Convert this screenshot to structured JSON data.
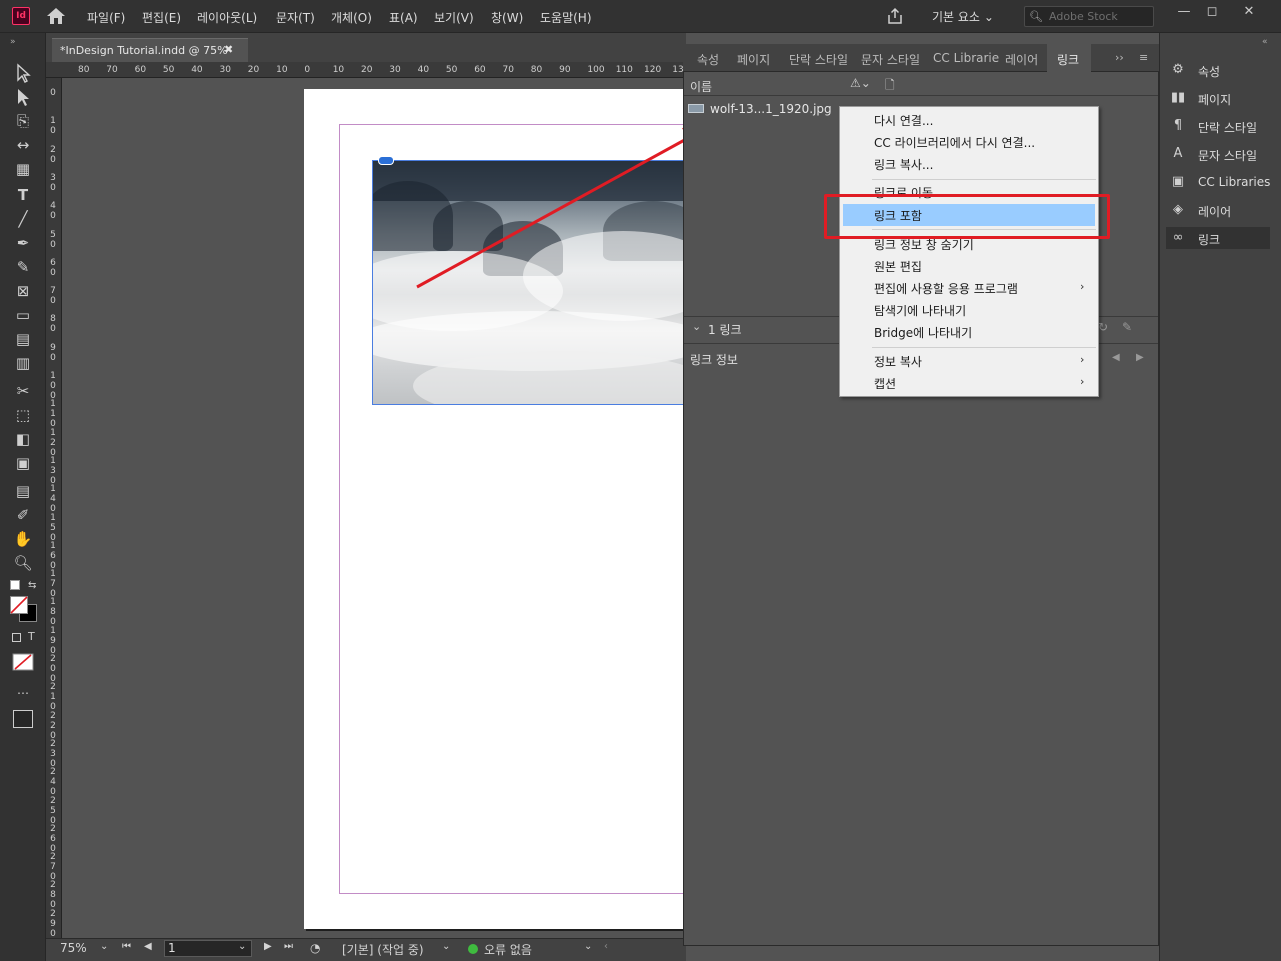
{
  "menubar": {
    "logo": "Id",
    "items": [
      "파일(F)",
      "편집(E)",
      "레이아웃(L)",
      "문자(T)",
      "개체(O)",
      "표(A)",
      "보기(V)",
      "창(W)",
      "도움말(H)"
    ],
    "workspace": "기본 요소",
    "stock_placeholder": "Adobe Stock",
    "win_minimize": "—",
    "win_restore": "◻",
    "win_close": "✕"
  },
  "document": {
    "tab_title": "*InDesign Tutorial.indd @ 75%",
    "tab_close": "✖"
  },
  "ruler": {
    "h_labels": [
      "80",
      "70",
      "60",
      "50",
      "40",
      "30",
      "20",
      "10",
      "0",
      "10",
      "20",
      "30",
      "40",
      "50",
      "60",
      "70",
      "80",
      "90",
      "100",
      "110",
      "120",
      "13"
    ],
    "v_labels": [
      "0",
      "1\n0",
      "2\n0",
      "3\n0",
      "4\n0",
      "5\n0",
      "6\n0",
      "7\n0",
      "8\n0",
      "9\n0",
      "1\n0\n0",
      "1\n1\n0",
      "1\n2\n0",
      "1\n3\n0",
      "1\n4\n0",
      "1\n5\n0",
      "1\n6\n0",
      "1\n7\n0",
      "1\n8\n0",
      "1\n9\n0",
      "2\n0\n0",
      "2\n1\n0",
      "2\n2\n0",
      "2\n3\n0",
      "2\n4\n0",
      "2\n5\n0",
      "2\n6\n0",
      "2\n7\n0",
      "2\n8\n0",
      "2\n9\n0"
    ]
  },
  "statusbar": {
    "zoom": "75%",
    "page": "1",
    "profile": "[기본] (작업 중)",
    "errors": "오류 없음"
  },
  "panel": {
    "tabs": [
      "속성",
      "페이지",
      "단락 스타일",
      "문자 스타일",
      "CC Librarie",
      "레이어",
      "링크"
    ],
    "col_name": "이름",
    "link_file": "wolf-13...1_1920.jpg",
    "link_count": "1 링크",
    "link_info": "링크 정보"
  },
  "context_menu": {
    "items": [
      {
        "label": "다시 연결...",
        "submenu": false
      },
      {
        "label": "CC 라이브러리에서 다시 연결...",
        "submenu": false
      },
      {
        "label": "링크 복사...",
        "submenu": false
      },
      {
        "label": "링크로 이동",
        "submenu": false
      },
      {
        "label": "링크 포함",
        "submenu": false,
        "highlighted": true
      },
      {
        "label": "링크 정보 창 숨기기",
        "submenu": false
      },
      {
        "label": "원본 편집",
        "submenu": false
      },
      {
        "label": "편집에 사용할 응용 프로그램",
        "submenu": true
      },
      {
        "label": "탐색기에 나타내기",
        "submenu": false
      },
      {
        "label": "Bridge에 나타내기",
        "submenu": false
      },
      {
        "label": "정보 복사",
        "submenu": true
      },
      {
        "label": "캡션",
        "submenu": true
      }
    ],
    "arrow": "›"
  },
  "dock": {
    "items": [
      {
        "label": "속성",
        "icon": "properties-icon"
      },
      {
        "label": "페이지",
        "icon": "pages-icon"
      },
      {
        "label": "단락 스타일",
        "icon": "paragraph-style-icon"
      },
      {
        "label": "문자 스타일",
        "icon": "character-style-icon"
      },
      {
        "label": "CC Libraries",
        "icon": "cc-libraries-icon"
      },
      {
        "label": "레이어",
        "icon": "layers-icon"
      },
      {
        "label": "링크",
        "icon": "links-icon"
      }
    ]
  },
  "colors": {
    "highlight": "#99ccff",
    "annotation_red": "#e01c24",
    "no_error_green": "#3fbb3f"
  }
}
